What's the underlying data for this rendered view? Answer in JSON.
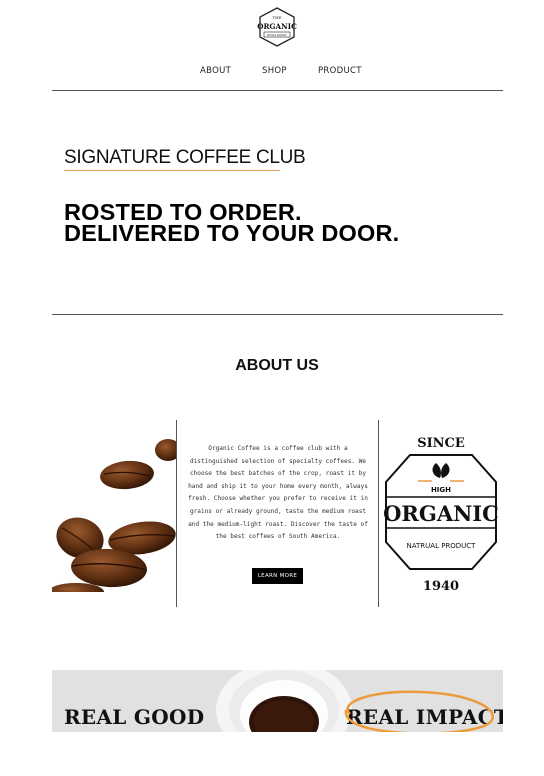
{
  "logo": {
    "top_text": "THE",
    "main_text": "ORGANIC",
    "sub_text": "ROYAL ROAST"
  },
  "nav": {
    "items": [
      {
        "label": "ABOUT"
      },
      {
        "label": "SHOP"
      },
      {
        "label": "PRODUCT"
      }
    ]
  },
  "hero": {
    "kicker": "SIGNATURE COFFEE CLUB",
    "headline_line1": "ROSTED TO ORDER.",
    "headline_line2": "DELIVERED TO YOUR DOOR."
  },
  "about": {
    "title": "ABOUT US",
    "body": "Organic Coffee is a coffee club with a distinguished selection of specialty coffees. We choose the best batches of the crop, roast it by hand and ship it to your home every month, always fresh. Choose whether you prefer to receive it in grains or already ground, taste the medium roast and the medium-light roast. Discover the taste of the best coffees of South America.",
    "button_label": "LEARN MORE"
  },
  "badge": {
    "since": "SINCE",
    "high": "HIGH",
    "organic": "ORGANIC",
    "natrual": "NATRUAL PRODUCT",
    "year": "1940",
    "accent_color": "#e38a2f"
  },
  "banner": {
    "left_text": "REAL GOOD",
    "right_text": "REAL IMPACT",
    "circle_color": "#ec9a3c"
  }
}
